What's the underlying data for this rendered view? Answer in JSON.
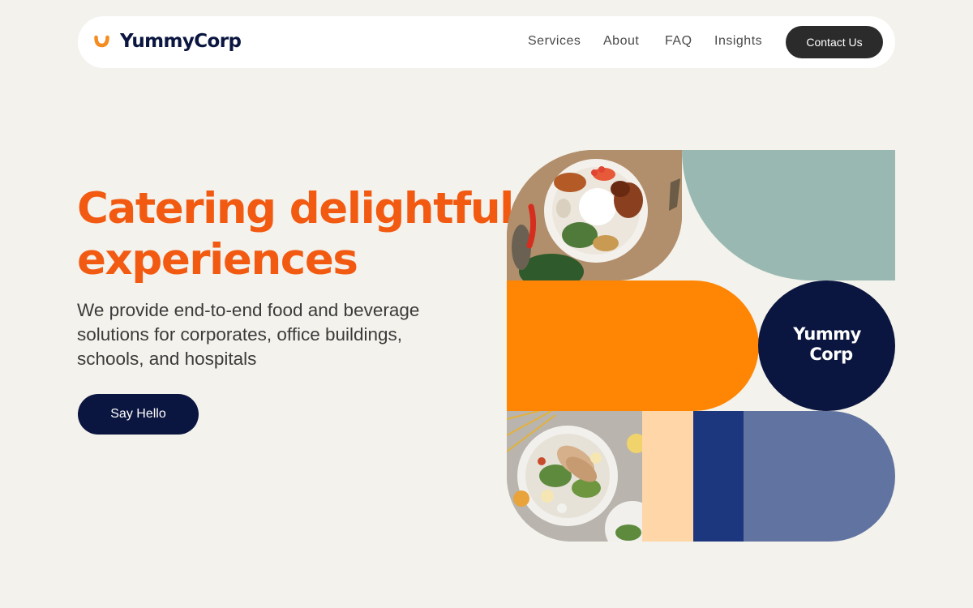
{
  "nav": {
    "logo_text": "YummyCorp",
    "links": [
      "Services",
      "About",
      "FAQ",
      "Insights"
    ],
    "contact_label": "Contact Us"
  },
  "hero": {
    "title_line1": "Catering delightful",
    "title_line2": "experiences",
    "description": "We provide end-to-end food and beverage solutions for corporates, office buildings, schools, and hospitals",
    "cta_label": "Say Hello"
  },
  "collage": {
    "logo_line1": "Yummy",
    "logo_line2": "Corp",
    "colors": {
      "sage": "#99b8b1",
      "orange": "#ff8605",
      "navy": "#0b1640",
      "peach": "#ffd6a8",
      "royal_blue": "#1d377f",
      "periwinkle": "#6173a0"
    }
  },
  "colors": {
    "background": "#f3f2ec",
    "brand_orange": "#f25a12",
    "brand_navy": "#0b1640",
    "logo_accent": "#f68b1f"
  },
  "icons": {
    "logo_mark": "smile-logo-icon"
  }
}
